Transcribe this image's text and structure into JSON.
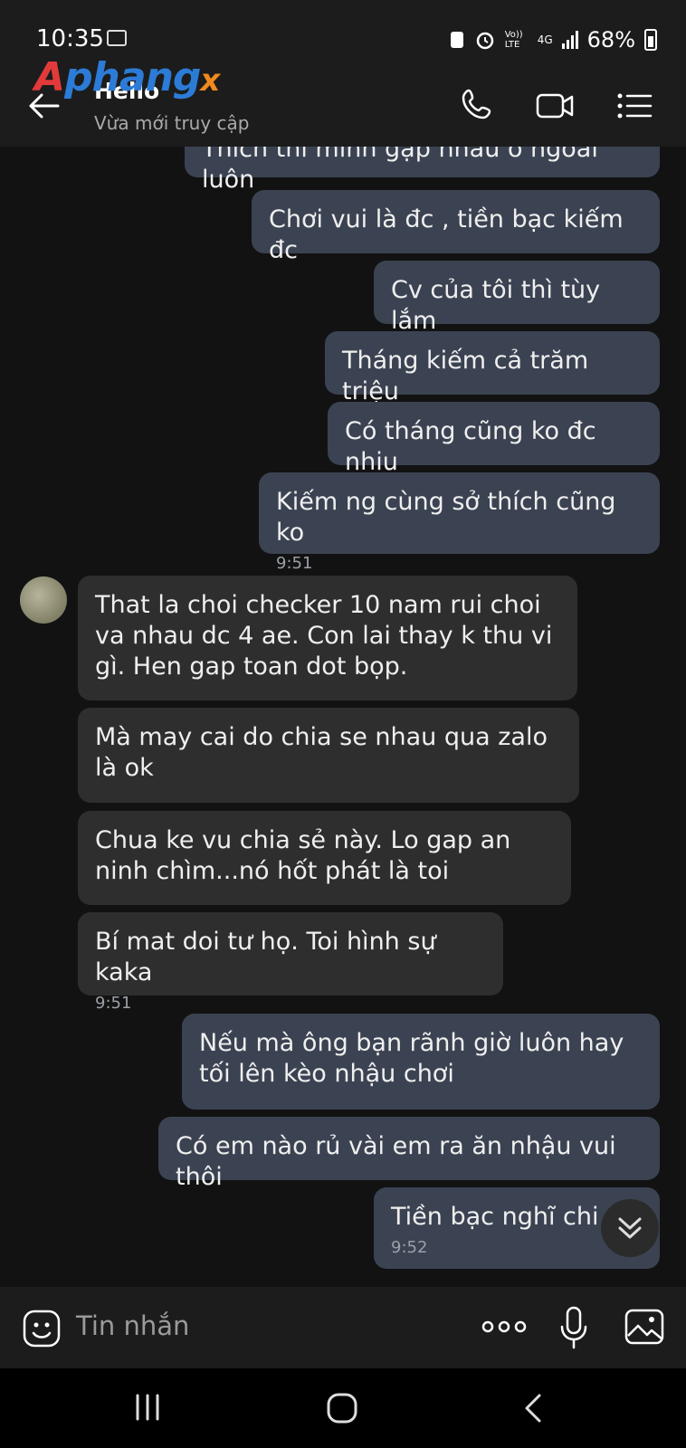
{
  "status_bar": {
    "time": "10:35",
    "network": "4G",
    "volte": "Vo)) LTE",
    "battery": "68%"
  },
  "header": {
    "brand": {
      "first": "A",
      "middle": "phang",
      "last": "x"
    },
    "title": "Hello",
    "subtitle": "Vừa mới truy cập"
  },
  "messages": [
    {
      "from": "me",
      "text": "Thích thì mình gặp nhau ở ngoài luôn"
    },
    {
      "from": "me",
      "text": "Chơi vui là đc , tiền bạc kiếm đc"
    },
    {
      "from": "me",
      "text": "Cv của tôi thì tùy lắm"
    },
    {
      "from": "me",
      "text": "Tháng kiếm cả trăm triệu"
    },
    {
      "from": "me",
      "text": "Có tháng cũng ko đc nhiu"
    },
    {
      "from": "me",
      "text": "Kiếm ng cùng sở thích cũng ko",
      "time": "9:51"
    },
    {
      "from": "them",
      "text": "That la choi checker 10 nam rui choi va nhau dc 4 ae. Con lai thay k thu vi gì. Hen gap toan dot bọp."
    },
    {
      "from": "them",
      "text": "Mà may cai do chia se nhau qua zalo là ok"
    },
    {
      "from": "them",
      "text": "Chua ke vu chia sẻ này. Lo gap an ninh chìm...nó hốt phát là toi"
    },
    {
      "from": "them",
      "text": "Bí mat doi tư họ. Toi hình sự kaka",
      "time": "9:51"
    },
    {
      "from": "me",
      "text": "Nếu mà ông bạn rãnh giờ luôn hay tối lên kèo nhậu chơi"
    },
    {
      "from": "me",
      "text": "Có em nào rủ vài em ra ăn nhậu vui thôi"
    },
    {
      "from": "me",
      "text": "Tiền bạc nghĩ chi n",
      "time": "9:52"
    }
  ],
  "input": {
    "placeholder": "Tin nhắn"
  },
  "colors": {
    "my_bubble": "#3b4352",
    "their_bubble": "#2e2e2e",
    "background": "#121212",
    "bars": "#1c1c1c"
  }
}
